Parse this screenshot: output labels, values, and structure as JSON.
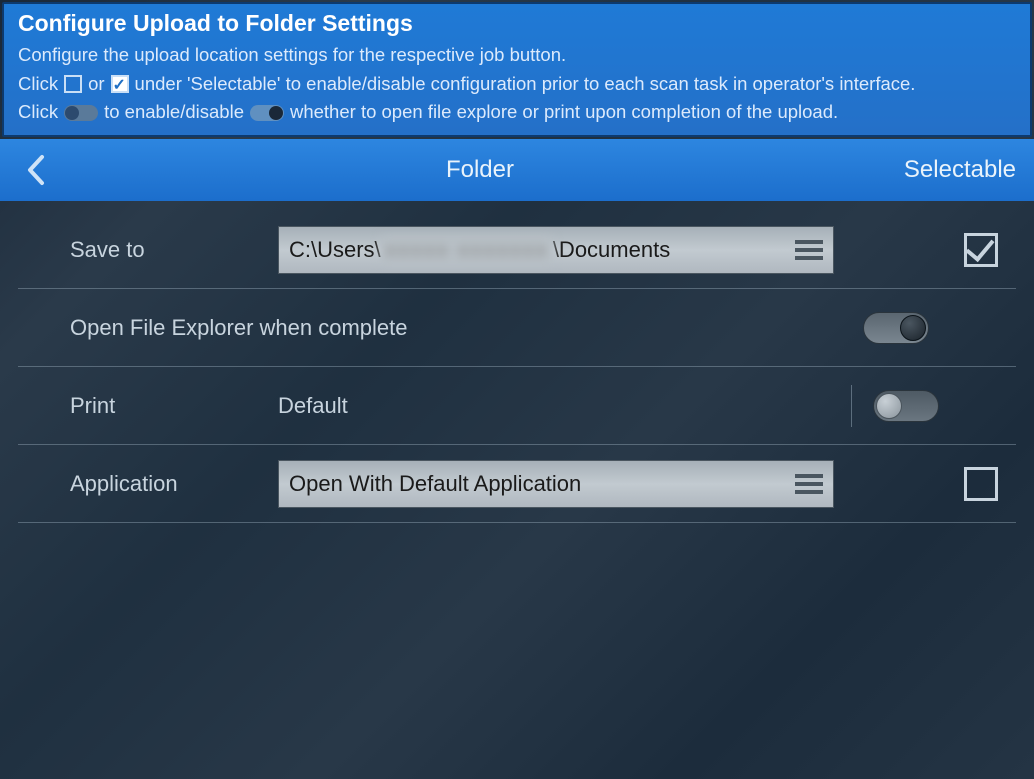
{
  "header": {
    "title": "Configure Upload to Folder Settings",
    "line1": "Configure the upload location settings for the respective job button.",
    "line2a": "Click",
    "line2b": "or",
    "line2c": "under 'Selectable' to enable/disable configuration prior to each scan task in operator's interface.",
    "line3a": "Click",
    "line3b": "to enable/disable",
    "line3c": "whether to open file explore or print upon completion of the upload."
  },
  "nav": {
    "title": "Folder",
    "selectable": "Selectable"
  },
  "rows": {
    "save_to": {
      "label": "Save to",
      "value_prefix": "C:\\Users\\",
      "value_redacted": "xxxxx xxxxxxx",
      "value_suffix": "\\Documents",
      "selectable_checked": true
    },
    "open_explorer": {
      "label": "Open File Explorer when complete",
      "toggle_on": true
    },
    "print": {
      "label": "Print",
      "value": "Default",
      "toggle_on": false
    },
    "application": {
      "label": "Application",
      "value": "Open With Default Application",
      "selectable_checked": false
    }
  }
}
